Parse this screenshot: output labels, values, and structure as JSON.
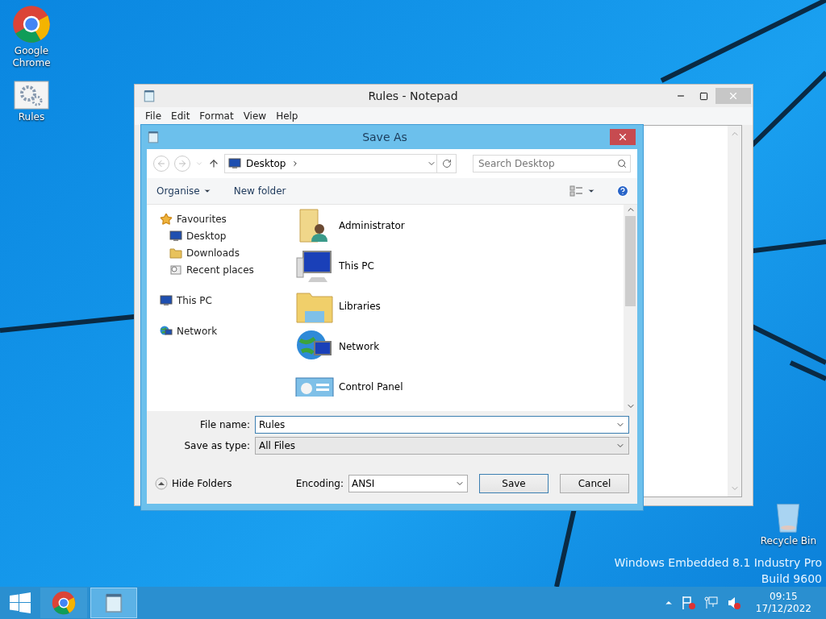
{
  "desktop": {
    "icons": [
      {
        "label": "Google Chrome",
        "kind": "chrome"
      },
      {
        "label": "Rules",
        "kind": "settings"
      }
    ],
    "recycle_bin": {
      "label": "Recycle Bin"
    },
    "edition": [
      "Windows Embedded 8.1 Industry Pro",
      "Build 9600"
    ]
  },
  "notepad": {
    "title": "Rules - Notepad",
    "menu": [
      "File",
      "Edit",
      "Format",
      "View",
      "Help"
    ]
  },
  "save_dialog": {
    "title": "Save As",
    "address": "Desktop",
    "search": {
      "placeholder": "Search Desktop"
    },
    "toolbar": [
      "Organise",
      "New folder"
    ],
    "nav_tree": [
      {
        "label": "Favourites",
        "kind": "star",
        "children": [
          {
            "label": "Desktop",
            "kind": "desktop"
          },
          {
            "label": "Downloads",
            "kind": "downloads"
          },
          {
            "label": "Recent places",
            "kind": "recent"
          }
        ]
      },
      {
        "label": "This PC",
        "kind": "pc"
      },
      {
        "label": "Network",
        "kind": "network"
      }
    ],
    "items": [
      {
        "label": "Administrator",
        "kind": "user"
      },
      {
        "label": "This PC",
        "kind": "pc"
      },
      {
        "label": "Libraries",
        "kind": "libraries"
      },
      {
        "label": "Network",
        "kind": "network"
      },
      {
        "label": "Control Panel",
        "kind": "control"
      }
    ],
    "file_name": {
      "label": "File name:",
      "value": "Rules"
    },
    "save_type": {
      "label": "Save as type:",
      "value": "All Files"
    },
    "hide_folders": "Hide Folders",
    "encoding": {
      "label": "Encoding:",
      "value": "ANSI"
    },
    "buttons": [
      {
        "label": "Save",
        "kind": "default"
      },
      {
        "label": "Cancel",
        "kind": "normal"
      }
    ]
  },
  "taskbar": {
    "apps": [
      {
        "kind": "chrome",
        "selected": false
      },
      {
        "kind": "notepad",
        "selected": true
      }
    ],
    "time": "09:15",
    "date": "17/12/2022"
  }
}
